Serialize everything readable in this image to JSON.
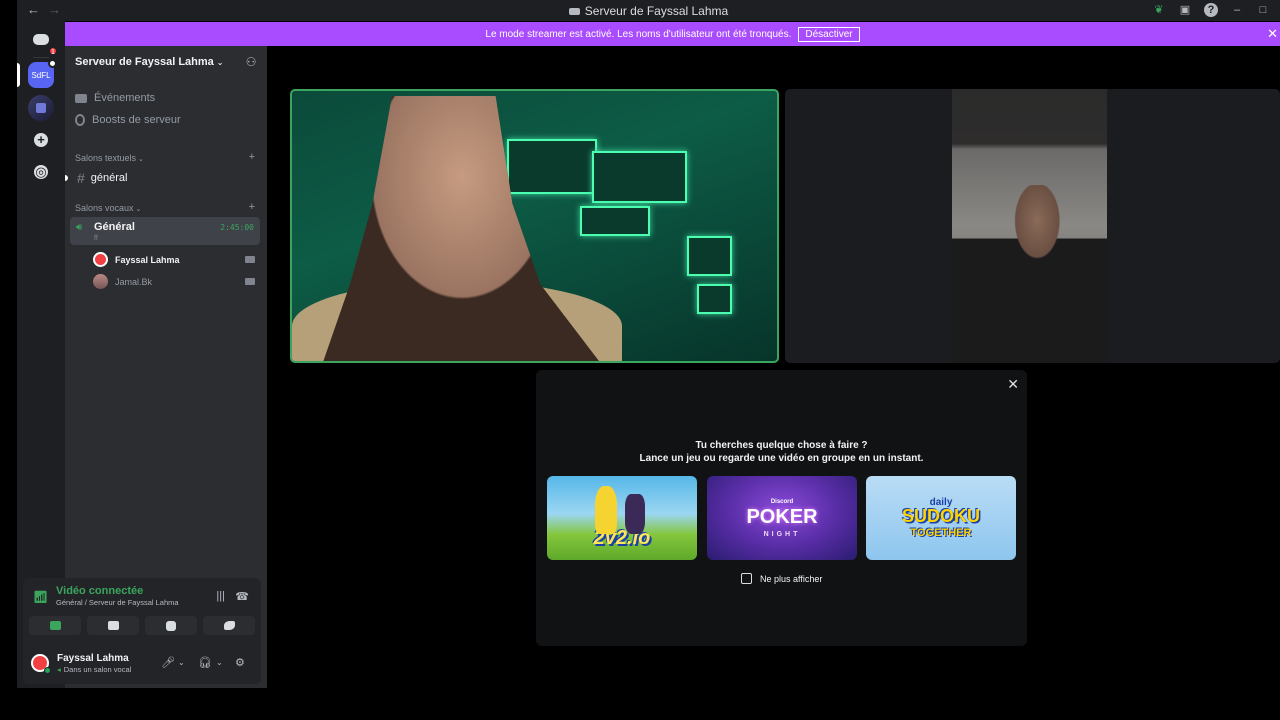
{
  "window": {
    "title": "Serveur de Fayssal Lahma",
    "nav_back": "←",
    "nav_forward": "→",
    "help_icon": "?",
    "minimize": "–",
    "maximize": "□"
  },
  "banner": {
    "text": "Le mode streamer est activé. Les noms d'utilisateur ont été tronqués.",
    "button": "Désactiver",
    "close": "✕",
    "color": "#a94cff"
  },
  "rail": {
    "home_badge": "1",
    "server_selected": "SdFL"
  },
  "server": {
    "name": "Serveur de Fayssal Lahma",
    "chevron": "⌄",
    "items": [
      {
        "label": "Événements"
      },
      {
        "label": "Boosts de serveur"
      }
    ]
  },
  "categories": {
    "text": "Salons textuels",
    "voice": "Salons vocaux",
    "add": "+"
  },
  "text_channel": {
    "name": "général",
    "hash": "#"
  },
  "voice_channel": {
    "name": "Général",
    "sub": "ff",
    "timer": "2:45:00",
    "users": [
      {
        "name": "Fayssal Lahma"
      },
      {
        "name": "Jamal.Bk"
      }
    ]
  },
  "voice_panel": {
    "status": "Vidéo connectée",
    "where": "Général / Serveur de Fayssal Lahma",
    "accent": "#3ba55d"
  },
  "user_panel": {
    "name": "Fayssal Lahma",
    "status": "Dans un salon vocal"
  },
  "activities": {
    "heading": "Tu cherches quelque chose à faire ?",
    "subheading": "Lance un jeu ou regarde une vidéo en groupe en un instant.",
    "close": "✕",
    "cards": [
      {
        "title": "2v2.io"
      },
      {
        "brand": "Discord",
        "title": "POKER",
        "subtitle": "NIGHT"
      },
      {
        "daily": "daily",
        "title": "SUDOKU",
        "subtitle": "TOGETHER"
      }
    ],
    "checkbox_label": "Ne plus afficher"
  }
}
